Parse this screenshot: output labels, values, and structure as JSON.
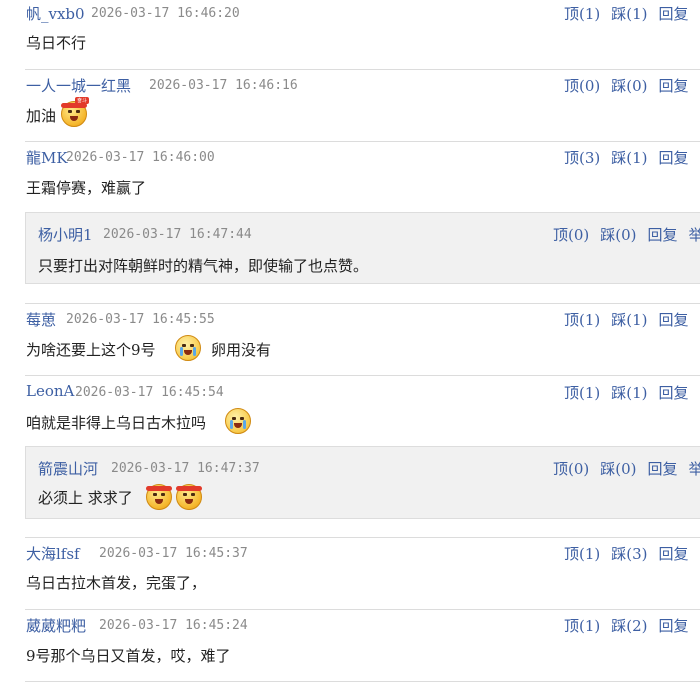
{
  "comments": [
    {
      "user": "帆_vxb0",
      "time": "2026-03-17 16:46:20",
      "up": "顶(1)",
      "down": "踩(1)",
      "reply": "回复",
      "text": "乌日不行"
    },
    {
      "user": "一人一城一红黑",
      "time": "2026-03-17 16:46:16",
      "up": "顶(0)",
      "down": "踩(0)",
      "reply": "回复",
      "text": "加油"
    },
    {
      "user": "龍MK",
      "time": "2026-03-17 16:46:00",
      "up": "顶(3)",
      "down": "踩(1)",
      "reply": "回复",
      "text": "王霜停赛，难赢了",
      "sub": {
        "user": "杨小明1",
        "time": "2026-03-17 16:47:44",
        "up": "顶(0)",
        "down": "踩(0)",
        "reply": "回复",
        "report": "举",
        "text": "只要打出对阵朝鲜时的精气神，即使输了也点赞。"
      }
    },
    {
      "user": "莓葸",
      "time": "2026-03-17 16:45:55",
      "up": "顶(1)",
      "down": "踩(1)",
      "reply": "回复",
      "text_a": "为啥还要上这个9号",
      "text_b": "卵用没有"
    },
    {
      "user": "LeonA",
      "time": "2026-03-17 16:45:54",
      "up": "顶(1)",
      "down": "踩(1)",
      "reply": "回复",
      "text": "咱就是非得上乌日古木拉吗",
      "sub": {
        "user": "箭震山河",
        "time": "2026-03-17 16:47:37",
        "up": "顶(0)",
        "down": "踩(0)",
        "reply": "回复",
        "report": "举",
        "text": "必须上 求求了"
      }
    },
    {
      "user": "大海lfsf",
      "time": "2026-03-17 16:45:37",
      "up": "顶(1)",
      "down": "踩(3)",
      "reply": "回复",
      "text": "乌日古拉木首发，完蛋了，"
    },
    {
      "user": "葳葳粑粑",
      "time": "2026-03-17 16:45:24",
      "up": "顶(1)",
      "down": "踩(2)",
      "reply": "回复",
      "text": "9号那个乌日又首发，哎，难了"
    }
  ],
  "emoji_labels": {
    "fist_tag": "奋斗"
  }
}
